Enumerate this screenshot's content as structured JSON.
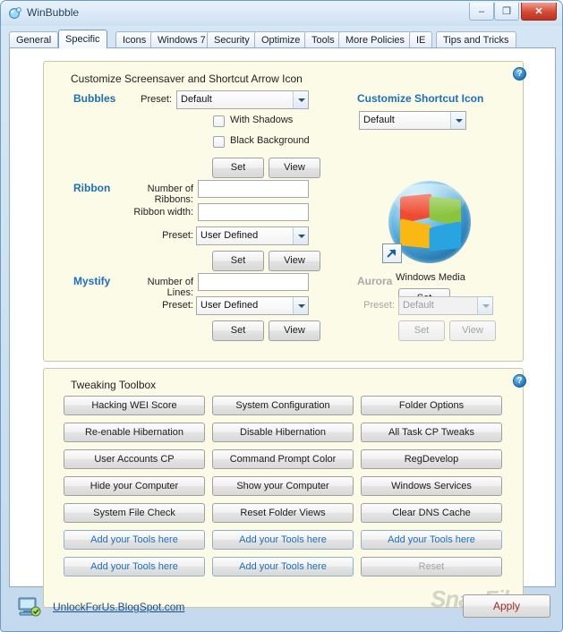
{
  "window": {
    "title": "WinBubble",
    "app_icon": "winbubble-icon",
    "minimize_label": "–",
    "maximize_label": "❐",
    "close_label": "✕"
  },
  "tabs": [
    {
      "label": "General",
      "active": false
    },
    {
      "label": "Specific",
      "active": true
    },
    {
      "label": "Icons",
      "active": false
    },
    {
      "label": "Windows 7",
      "active": false
    },
    {
      "label": "Security",
      "active": false
    },
    {
      "label": "Optimize",
      "active": false
    },
    {
      "label": "Tools",
      "active": false
    },
    {
      "label": "More Policies",
      "active": false
    },
    {
      "label": "IE",
      "active": false
    },
    {
      "label": "Tips and Tricks",
      "active": false
    }
  ],
  "screensaver_group": {
    "title": "Customize Screensaver and Shortcut Arrow Icon",
    "help_label": "?",
    "bubbles": {
      "section": "Bubbles",
      "preset_label": "Preset:",
      "preset_value": "Default",
      "with_shadows_label": "With Shadows",
      "with_shadows_checked": false,
      "black_background_label": "Black Background",
      "black_background_checked": false,
      "set_label": "Set",
      "view_label": "View"
    },
    "ribbon": {
      "section": "Ribbon",
      "number_label": "Number of Ribbons:",
      "number_value": "",
      "width_label": "Ribbon width:",
      "width_value": "",
      "preset_label": "Preset:",
      "preset_value": "User Defined",
      "set_label": "Set",
      "view_label": "View"
    },
    "mystify": {
      "section": "Mystify",
      "lines_label": "Number of Lines:",
      "lines_value": "",
      "preset_label": "Preset:",
      "preset_value": "User Defined",
      "set_label": "Set",
      "view_label": "View"
    },
    "shortcut": {
      "section": "Customize Shortcut Icon",
      "preset_value": "Default",
      "caption": "Windows Media",
      "set_label": "Set",
      "overlay_icon": "shortcut-arrow-icon"
    },
    "aurora": {
      "section": "Aurora",
      "preset_label": "Preset:",
      "preset_value": "Default",
      "set_label": "Set",
      "view_label": "View",
      "enabled": false
    }
  },
  "toolbox_group": {
    "title": "Tweaking Toolbox",
    "help_label": "?",
    "rows": [
      [
        "Hacking WEI Score",
        "System Configuration",
        "Folder Options"
      ],
      [
        "Re-enable Hibernation",
        "Disable Hibernation",
        "All Task CP Tweaks"
      ],
      [
        "User Accounts CP",
        "Command Prompt Color",
        "RegDevelop"
      ],
      [
        "Hide your Computer",
        "Show your Computer",
        "Windows Services"
      ],
      [
        "System File Check",
        "Reset Folder Views",
        "Clear DNS Cache"
      ],
      [
        "Add your Tools here",
        "Add your Tools here",
        "Add your Tools here"
      ],
      [
        "Add your Tools here",
        "Add your Tools here",
        "Reset"
      ]
    ],
    "placeholder_rows": [
      5,
      6
    ],
    "disabled_buttons": [
      "Reset"
    ]
  },
  "statusbar": {
    "icon": "computer-icon",
    "link_text": "UnlockForUs.BlogSpot.com",
    "apply_label": "Apply"
  },
  "watermark": "SnapFiles",
  "colors": {
    "accent_blue": "#1e6fb8",
    "group_bg": "#fbfbe8",
    "apply_text": "#9e2d24",
    "close_red": "#d24a35"
  }
}
